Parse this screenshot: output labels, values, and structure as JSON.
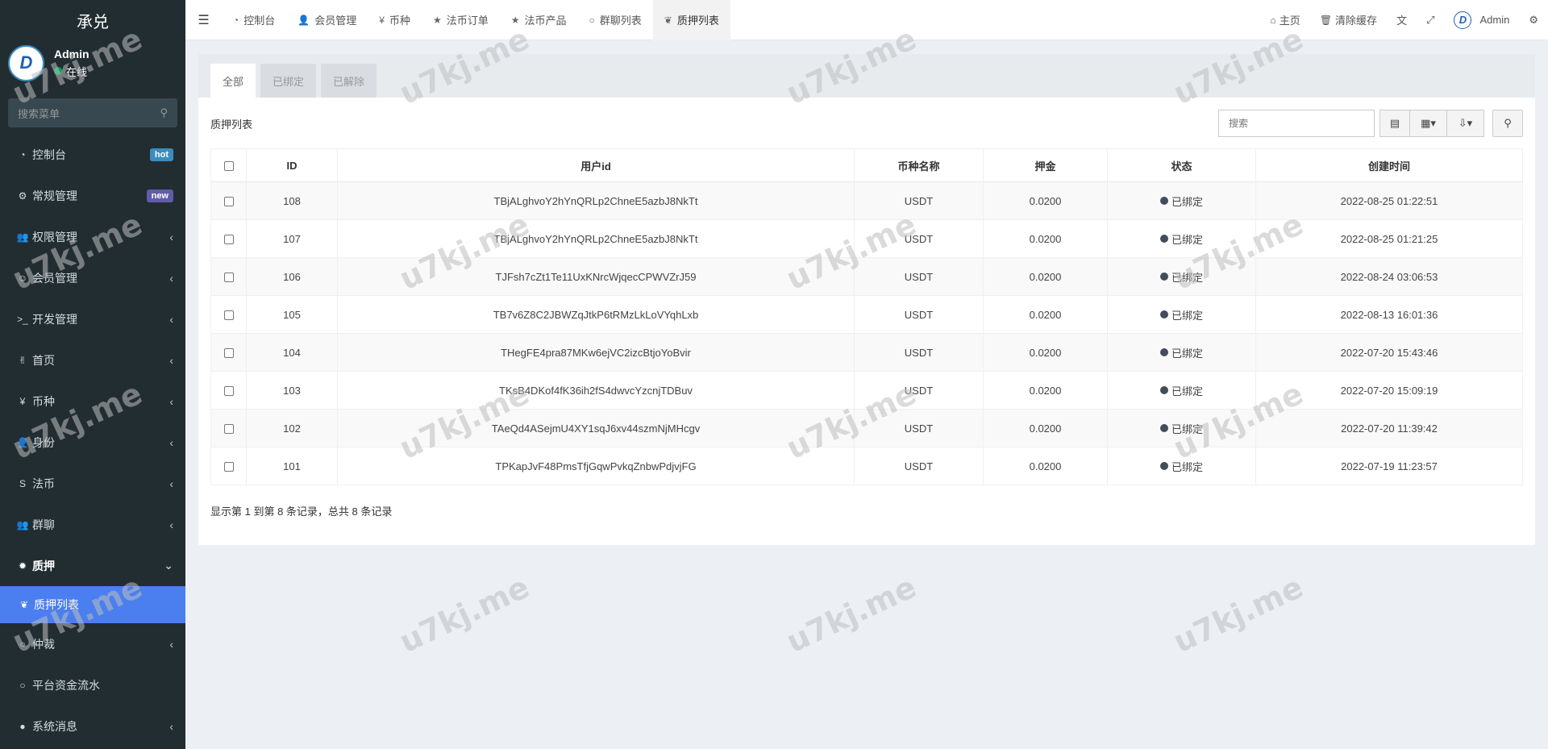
{
  "sidebar": {
    "logo": "承兑",
    "avatar_letter": "D",
    "user_name": "Admin",
    "user_status": "在线",
    "search_placeholder": "搜索菜单",
    "items": [
      {
        "icon": "dashboard-icon",
        "glyph": "◔",
        "label": "控制台",
        "badge": "hot"
      },
      {
        "icon": "cogs-icon",
        "glyph": "⚙",
        "label": "常规管理",
        "badge": "new"
      },
      {
        "icon": "group-icon",
        "glyph": "👥",
        "label": "权限管理"
      },
      {
        "icon": "user-circle-icon",
        "glyph": "☺",
        "label": "会员管理"
      },
      {
        "icon": "terminal-icon",
        "glyph": ">_",
        "label": "开发管理"
      },
      {
        "icon": "victory-hand-icon",
        "glyph": "✌",
        "label": "首页"
      },
      {
        "icon": "yen-icon",
        "glyph": "¥",
        "label": "币种"
      },
      {
        "icon": "user-icon",
        "glyph": "👤",
        "label": "身份"
      },
      {
        "icon": "skype-icon",
        "glyph": "S",
        "label": "法币"
      },
      {
        "icon": "users-icon",
        "glyph": "👥",
        "label": "群聊"
      },
      {
        "icon": "gear-icon",
        "glyph": "✹",
        "label": "质押",
        "open": true
      },
      {
        "icon": "leaf-icon",
        "glyph": "❦",
        "label": "质押列表",
        "active": true
      },
      {
        "icon": "circle-icon",
        "glyph": "○",
        "label": "仲裁"
      },
      {
        "icon": "circle-icon",
        "glyph": "○",
        "label": "平台资金流水"
      },
      {
        "icon": "comment-icon",
        "glyph": "●",
        "label": "系统消息"
      }
    ]
  },
  "topbar": {
    "tabs": [
      {
        "icon": "dashboard-icon",
        "glyph": "◔",
        "label": "控制台"
      },
      {
        "icon": "user-icon",
        "glyph": "👤",
        "label": "会员管理"
      },
      {
        "icon": "yen-icon",
        "glyph": "¥",
        "label": "币种"
      },
      {
        "icon": "star-icon",
        "glyph": "★",
        "label": "法币订单"
      },
      {
        "icon": "star-icon",
        "glyph": "★",
        "label": "法币产品"
      },
      {
        "icon": "circle-icon",
        "glyph": "○",
        "label": "群聊列表"
      },
      {
        "icon": "leaf-icon",
        "glyph": "❦",
        "label": "质押列表",
        "active": true
      }
    ],
    "home": "主页",
    "clear_cache": "清除缓存",
    "user": "Admin"
  },
  "content": {
    "subtabs": [
      "全部",
      "已绑定",
      "已解除"
    ],
    "panel_title": "质押列表",
    "search_placeholder": "搜索",
    "columns": [
      "ID",
      "用户id",
      "币种名称",
      "押金",
      "状态",
      "创建时间"
    ],
    "rows": [
      {
        "id": "108",
        "user": "TBjALghvoY2hYnQRLp2ChneE5azbJ8NkTt",
        "coin": "USDT",
        "deposit": "0.0200",
        "status": "已绑定",
        "time": "2022-08-25 01:22:51"
      },
      {
        "id": "107",
        "user": "TBjALghvoY2hYnQRLp2ChneE5azbJ8NkTt",
        "coin": "USDT",
        "deposit": "0.0200",
        "status": "已绑定",
        "time": "2022-08-25 01:21:25"
      },
      {
        "id": "106",
        "user": "TJFsh7cZt1Te11UxKNrcWjqecCPWVZrJ59",
        "coin": "USDT",
        "deposit": "0.0200",
        "status": "已绑定",
        "time": "2022-08-24 03:06:53"
      },
      {
        "id": "105",
        "user": "TB7v6Z8C2JBWZqJtkP6tRMzLkLoVYqhLxb",
        "coin": "USDT",
        "deposit": "0.0200",
        "status": "已绑定",
        "time": "2022-08-13 16:01:36"
      },
      {
        "id": "104",
        "user": "THegFE4pra87MKw6ejVC2izcBtjoYoBvir",
        "coin": "USDT",
        "deposit": "0.0200",
        "status": "已绑定",
        "time": "2022-07-20 15:43:46"
      },
      {
        "id": "103",
        "user": "TKsB4DKof4fK36ih2fS4dwvcYzcnjTDBuv",
        "coin": "USDT",
        "deposit": "0.0200",
        "status": "已绑定",
        "time": "2022-07-20 15:09:19"
      },
      {
        "id": "102",
        "user": "TAeQd4ASejmU4XY1sqJ6xv44szmNjMHcgv",
        "coin": "USDT",
        "deposit": "0.0200",
        "status": "已绑定",
        "time": "2022-07-20 11:39:42"
      },
      {
        "id": "101",
        "user": "TPKapJvF48PmsTfjGqwPvkqZnbwPdjvjFG",
        "coin": "USDT",
        "deposit": "0.0200",
        "status": "已绑定",
        "time": "2022-07-19 11:23:57"
      }
    ],
    "footer": "显示第 1 到第 8 条记录，总共 8 条记录"
  },
  "watermark": "u7kj.me",
  "colors": {
    "sidebar_bg": "#222d32",
    "active_menu": "#4b7ff0",
    "online": "#00a65a"
  }
}
